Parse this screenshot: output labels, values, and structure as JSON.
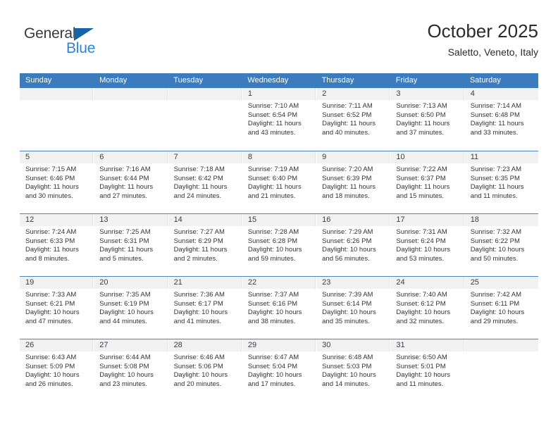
{
  "brand": {
    "name_top": "General",
    "name_bottom": "Blue",
    "accent_color": "#2a86d8",
    "triangle_color": "#1565a8"
  },
  "header": {
    "title": "October 2025",
    "subtitle": "Saletto, Veneto, Italy"
  },
  "theme": {
    "header_row_bg": "#3a7cbe",
    "header_row_text": "#ffffff",
    "daynum_strip_bg": "#f1f1f1",
    "week_border": "#4a86c4"
  },
  "weekdays": [
    "Sunday",
    "Monday",
    "Tuesday",
    "Wednesday",
    "Thursday",
    "Friday",
    "Saturday"
  ],
  "labels": {
    "sunrise_prefix": "Sunrise:",
    "sunset_prefix": "Sunset:",
    "daylight_prefix": "Daylight:"
  },
  "weeks": [
    [
      {
        "day": "",
        "sunrise": "",
        "sunset": "",
        "daylight_line1": "",
        "daylight_line2": ""
      },
      {
        "day": "",
        "sunrise": "",
        "sunset": "",
        "daylight_line1": "",
        "daylight_line2": ""
      },
      {
        "day": "",
        "sunrise": "",
        "sunset": "",
        "daylight_line1": "",
        "daylight_line2": ""
      },
      {
        "day": "1",
        "sunrise": "Sunrise: 7:10 AM",
        "sunset": "Sunset: 6:54 PM",
        "daylight_line1": "Daylight: 11 hours",
        "daylight_line2": "and 43 minutes."
      },
      {
        "day": "2",
        "sunrise": "Sunrise: 7:11 AM",
        "sunset": "Sunset: 6:52 PM",
        "daylight_line1": "Daylight: 11 hours",
        "daylight_line2": "and 40 minutes."
      },
      {
        "day": "3",
        "sunrise": "Sunrise: 7:13 AM",
        "sunset": "Sunset: 6:50 PM",
        "daylight_line1": "Daylight: 11 hours",
        "daylight_line2": "and 37 minutes."
      },
      {
        "day": "4",
        "sunrise": "Sunrise: 7:14 AM",
        "sunset": "Sunset: 6:48 PM",
        "daylight_line1": "Daylight: 11 hours",
        "daylight_line2": "and 33 minutes."
      }
    ],
    [
      {
        "day": "5",
        "sunrise": "Sunrise: 7:15 AM",
        "sunset": "Sunset: 6:46 PM",
        "daylight_line1": "Daylight: 11 hours",
        "daylight_line2": "and 30 minutes."
      },
      {
        "day": "6",
        "sunrise": "Sunrise: 7:16 AM",
        "sunset": "Sunset: 6:44 PM",
        "daylight_line1": "Daylight: 11 hours",
        "daylight_line2": "and 27 minutes."
      },
      {
        "day": "7",
        "sunrise": "Sunrise: 7:18 AM",
        "sunset": "Sunset: 6:42 PM",
        "daylight_line1": "Daylight: 11 hours",
        "daylight_line2": "and 24 minutes."
      },
      {
        "day": "8",
        "sunrise": "Sunrise: 7:19 AM",
        "sunset": "Sunset: 6:40 PM",
        "daylight_line1": "Daylight: 11 hours",
        "daylight_line2": "and 21 minutes."
      },
      {
        "day": "9",
        "sunrise": "Sunrise: 7:20 AM",
        "sunset": "Sunset: 6:39 PM",
        "daylight_line1": "Daylight: 11 hours",
        "daylight_line2": "and 18 minutes."
      },
      {
        "day": "10",
        "sunrise": "Sunrise: 7:22 AM",
        "sunset": "Sunset: 6:37 PM",
        "daylight_line1": "Daylight: 11 hours",
        "daylight_line2": "and 15 minutes."
      },
      {
        "day": "11",
        "sunrise": "Sunrise: 7:23 AM",
        "sunset": "Sunset: 6:35 PM",
        "daylight_line1": "Daylight: 11 hours",
        "daylight_line2": "and 11 minutes."
      }
    ],
    [
      {
        "day": "12",
        "sunrise": "Sunrise: 7:24 AM",
        "sunset": "Sunset: 6:33 PM",
        "daylight_line1": "Daylight: 11 hours",
        "daylight_line2": "and 8 minutes."
      },
      {
        "day": "13",
        "sunrise": "Sunrise: 7:25 AM",
        "sunset": "Sunset: 6:31 PM",
        "daylight_line1": "Daylight: 11 hours",
        "daylight_line2": "and 5 minutes."
      },
      {
        "day": "14",
        "sunrise": "Sunrise: 7:27 AM",
        "sunset": "Sunset: 6:29 PM",
        "daylight_line1": "Daylight: 11 hours",
        "daylight_line2": "and 2 minutes."
      },
      {
        "day": "15",
        "sunrise": "Sunrise: 7:28 AM",
        "sunset": "Sunset: 6:28 PM",
        "daylight_line1": "Daylight: 10 hours",
        "daylight_line2": "and 59 minutes."
      },
      {
        "day": "16",
        "sunrise": "Sunrise: 7:29 AM",
        "sunset": "Sunset: 6:26 PM",
        "daylight_line1": "Daylight: 10 hours",
        "daylight_line2": "and 56 minutes."
      },
      {
        "day": "17",
        "sunrise": "Sunrise: 7:31 AM",
        "sunset": "Sunset: 6:24 PM",
        "daylight_line1": "Daylight: 10 hours",
        "daylight_line2": "and 53 minutes."
      },
      {
        "day": "18",
        "sunrise": "Sunrise: 7:32 AM",
        "sunset": "Sunset: 6:22 PM",
        "daylight_line1": "Daylight: 10 hours",
        "daylight_line2": "and 50 minutes."
      }
    ],
    [
      {
        "day": "19",
        "sunrise": "Sunrise: 7:33 AM",
        "sunset": "Sunset: 6:21 PM",
        "daylight_line1": "Daylight: 10 hours",
        "daylight_line2": "and 47 minutes."
      },
      {
        "day": "20",
        "sunrise": "Sunrise: 7:35 AM",
        "sunset": "Sunset: 6:19 PM",
        "daylight_line1": "Daylight: 10 hours",
        "daylight_line2": "and 44 minutes."
      },
      {
        "day": "21",
        "sunrise": "Sunrise: 7:36 AM",
        "sunset": "Sunset: 6:17 PM",
        "daylight_line1": "Daylight: 10 hours",
        "daylight_line2": "and 41 minutes."
      },
      {
        "day": "22",
        "sunrise": "Sunrise: 7:37 AM",
        "sunset": "Sunset: 6:16 PM",
        "daylight_line1": "Daylight: 10 hours",
        "daylight_line2": "and 38 minutes."
      },
      {
        "day": "23",
        "sunrise": "Sunrise: 7:39 AM",
        "sunset": "Sunset: 6:14 PM",
        "daylight_line1": "Daylight: 10 hours",
        "daylight_line2": "and 35 minutes."
      },
      {
        "day": "24",
        "sunrise": "Sunrise: 7:40 AM",
        "sunset": "Sunset: 6:12 PM",
        "daylight_line1": "Daylight: 10 hours",
        "daylight_line2": "and 32 minutes."
      },
      {
        "day": "25",
        "sunrise": "Sunrise: 7:42 AM",
        "sunset": "Sunset: 6:11 PM",
        "daylight_line1": "Daylight: 10 hours",
        "daylight_line2": "and 29 minutes."
      }
    ],
    [
      {
        "day": "26",
        "sunrise": "Sunrise: 6:43 AM",
        "sunset": "Sunset: 5:09 PM",
        "daylight_line1": "Daylight: 10 hours",
        "daylight_line2": "and 26 minutes."
      },
      {
        "day": "27",
        "sunrise": "Sunrise: 6:44 AM",
        "sunset": "Sunset: 5:08 PM",
        "daylight_line1": "Daylight: 10 hours",
        "daylight_line2": "and 23 minutes."
      },
      {
        "day": "28",
        "sunrise": "Sunrise: 6:46 AM",
        "sunset": "Sunset: 5:06 PM",
        "daylight_line1": "Daylight: 10 hours",
        "daylight_line2": "and 20 minutes."
      },
      {
        "day": "29",
        "sunrise": "Sunrise: 6:47 AM",
        "sunset": "Sunset: 5:04 PM",
        "daylight_line1": "Daylight: 10 hours",
        "daylight_line2": "and 17 minutes."
      },
      {
        "day": "30",
        "sunrise": "Sunrise: 6:48 AM",
        "sunset": "Sunset: 5:03 PM",
        "daylight_line1": "Daylight: 10 hours",
        "daylight_line2": "and 14 minutes."
      },
      {
        "day": "31",
        "sunrise": "Sunrise: 6:50 AM",
        "sunset": "Sunset: 5:01 PM",
        "daylight_line1": "Daylight: 10 hours",
        "daylight_line2": "and 11 minutes."
      },
      {
        "day": "",
        "sunrise": "",
        "sunset": "",
        "daylight_line1": "",
        "daylight_line2": ""
      }
    ]
  ]
}
